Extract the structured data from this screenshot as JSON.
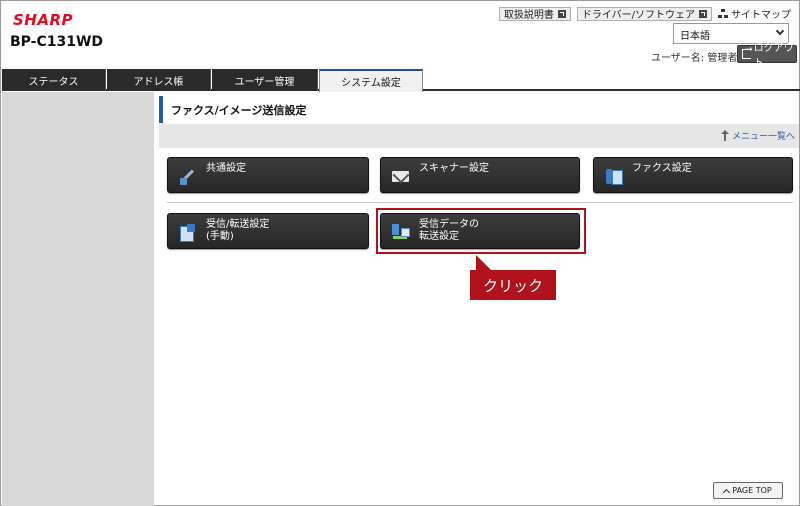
{
  "header": {
    "logo": "SHARP",
    "model": "BP-C131WD",
    "links": [
      "取扱説明書",
      "ドライバー/ソフトウェア"
    ],
    "sitemap": "サイトマップ",
    "language": "日本語",
    "user_label": "ユーザー名: 管理者",
    "logout": "ログアウト"
  },
  "tabs": [
    {
      "label": "ステータス"
    },
    {
      "label": "アドレス帳"
    },
    {
      "label": "ユーザー管理"
    },
    {
      "label": "システム設定"
    }
  ],
  "page": {
    "title": "ファクス/イメージ送信設定",
    "menu_link": "メニュー一覧へ"
  },
  "buttons": [
    {
      "label": "共通設定",
      "icon": "tools-icon"
    },
    {
      "label": "スキャナー設定",
      "icon": "mail-icon"
    },
    {
      "label": "ファクス設定",
      "icon": "fax-icon"
    },
    {
      "label": "受信/転送設定\n(手動)",
      "icon": "receive-icon"
    },
    {
      "label": "受信データの\n転送設定",
      "icon": "forward-icon"
    }
  ],
  "annotation": {
    "callout": "クリック",
    "color": "#b1121c"
  },
  "footer": {
    "page_top": "PAGE TOP"
  },
  "colors": {
    "brand": "#e8091e",
    "accent": "#1f5da8",
    "button_bg": "#2a2a2a"
  }
}
